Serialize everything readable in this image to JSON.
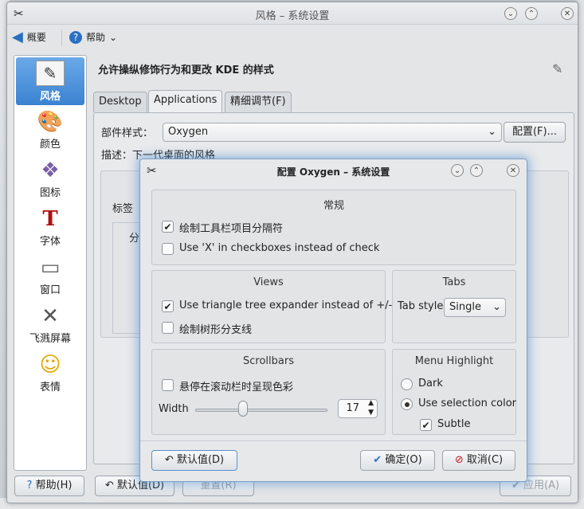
{
  "main": {
    "title": "风格 – 系统设置",
    "toolbar": {
      "overview": "概要",
      "help": "帮助",
      "help_arrow": "⌄"
    },
    "sidebar": [
      {
        "label": "风格",
        "icon": "style-icon",
        "glyph": "✎",
        "selected": true
      },
      {
        "label": "颜色",
        "icon": "color-palette-icon",
        "glyph": "🎨"
      },
      {
        "label": "图标",
        "icon": "icons-icon",
        "glyph": "❖"
      },
      {
        "label": "字体",
        "icon": "font-icon",
        "glyph": "T"
      },
      {
        "label": "窗口",
        "icon": "window-icon",
        "glyph": "▭"
      },
      {
        "label": "飞溅屏幕",
        "icon": "splash-tools-icon",
        "glyph": "✕"
      },
      {
        "label": "表情",
        "icon": "emoticon-icon",
        "glyph": "☺"
      }
    ],
    "header": "允许操纵修饰行为和更改 KDE 的样式",
    "tabs": [
      "Desktop",
      "Applications",
      "精细调节(F)"
    ],
    "widget_style_label": "部件样式：",
    "widget_style_value": "Oxygen",
    "configure_button": "配置(F)...",
    "description": "描述：下一代桌面的风格",
    "partial_label": "标签",
    "partial_group_char": "分",
    "buttons": {
      "help": "帮助(H)",
      "defaults": "默认值(D)",
      "reset": "重置(R)",
      "apply": "应用(A)"
    }
  },
  "dialog": {
    "title": "配置 Oxygen – 系统设置",
    "general": {
      "title": "常规",
      "opt1": "绘制工具栏项目分隔符",
      "opt1_checked": true,
      "opt2": "Use 'X' in checkboxes instead of check",
      "opt2_checked": false
    },
    "views": {
      "title": "Views",
      "opt1": "Use triangle tree expander instead of +/-",
      "opt1_checked": true,
      "opt2": "绘制树形分支线",
      "opt2_checked": false
    },
    "tabs": {
      "title": "Tabs",
      "style_label": "Tab style",
      "style_value": "Single"
    },
    "scrollbars": {
      "title": "Scrollbars",
      "opt1": "悬停在滚动栏时呈现色彩",
      "opt1_checked": false,
      "width_label": "Width",
      "width_value": "17",
      "width_slider_fraction": 0.36
    },
    "menu_highlight": {
      "title": "Menu Highlight",
      "dark": "Dark",
      "use_selection": "Use selection color",
      "subtle": "Subtle",
      "selected": "use_selection",
      "subtle_checked": true
    },
    "buttons": {
      "defaults": "默认值(D)",
      "ok": "确定(O)",
      "cancel": "取消(C)"
    }
  },
  "colors": {
    "accent": "#3b82d1",
    "focus_glow": "#508cd2"
  }
}
